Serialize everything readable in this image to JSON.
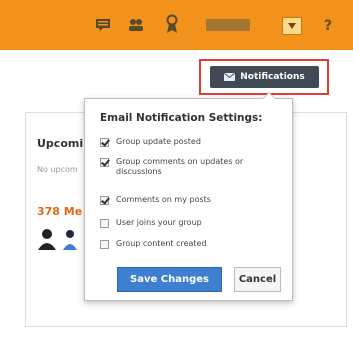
{
  "topbar": {
    "icons": [
      "chat-icon",
      "group-icon",
      "badge-icon",
      "dropdown-icon",
      "help-icon"
    ],
    "help_label": "?"
  },
  "notifications_button": {
    "label": "Notifications"
  },
  "background": {
    "upcoming_title": "Upcomi",
    "no_upcoming_text": "No upcom",
    "members_title": "378 Me"
  },
  "popup": {
    "title": "Email Notification Settings:",
    "options": [
      {
        "label": "Group update posted",
        "checked": true
      },
      {
        "label": "Group comments on updates or discussions",
        "checked": true
      },
      {
        "label": "Comments on my posts",
        "checked": true
      },
      {
        "label": "User joins your group",
        "checked": false
      },
      {
        "label": "Group content created",
        "checked": false
      }
    ],
    "save_label": "Save Changes",
    "cancel_label": "Cancel"
  },
  "colors": {
    "topbar": "#f0921c",
    "highlight": "#e53a3a",
    "primary_button": "#3f7fd0",
    "members_title": "#e06a1a"
  }
}
